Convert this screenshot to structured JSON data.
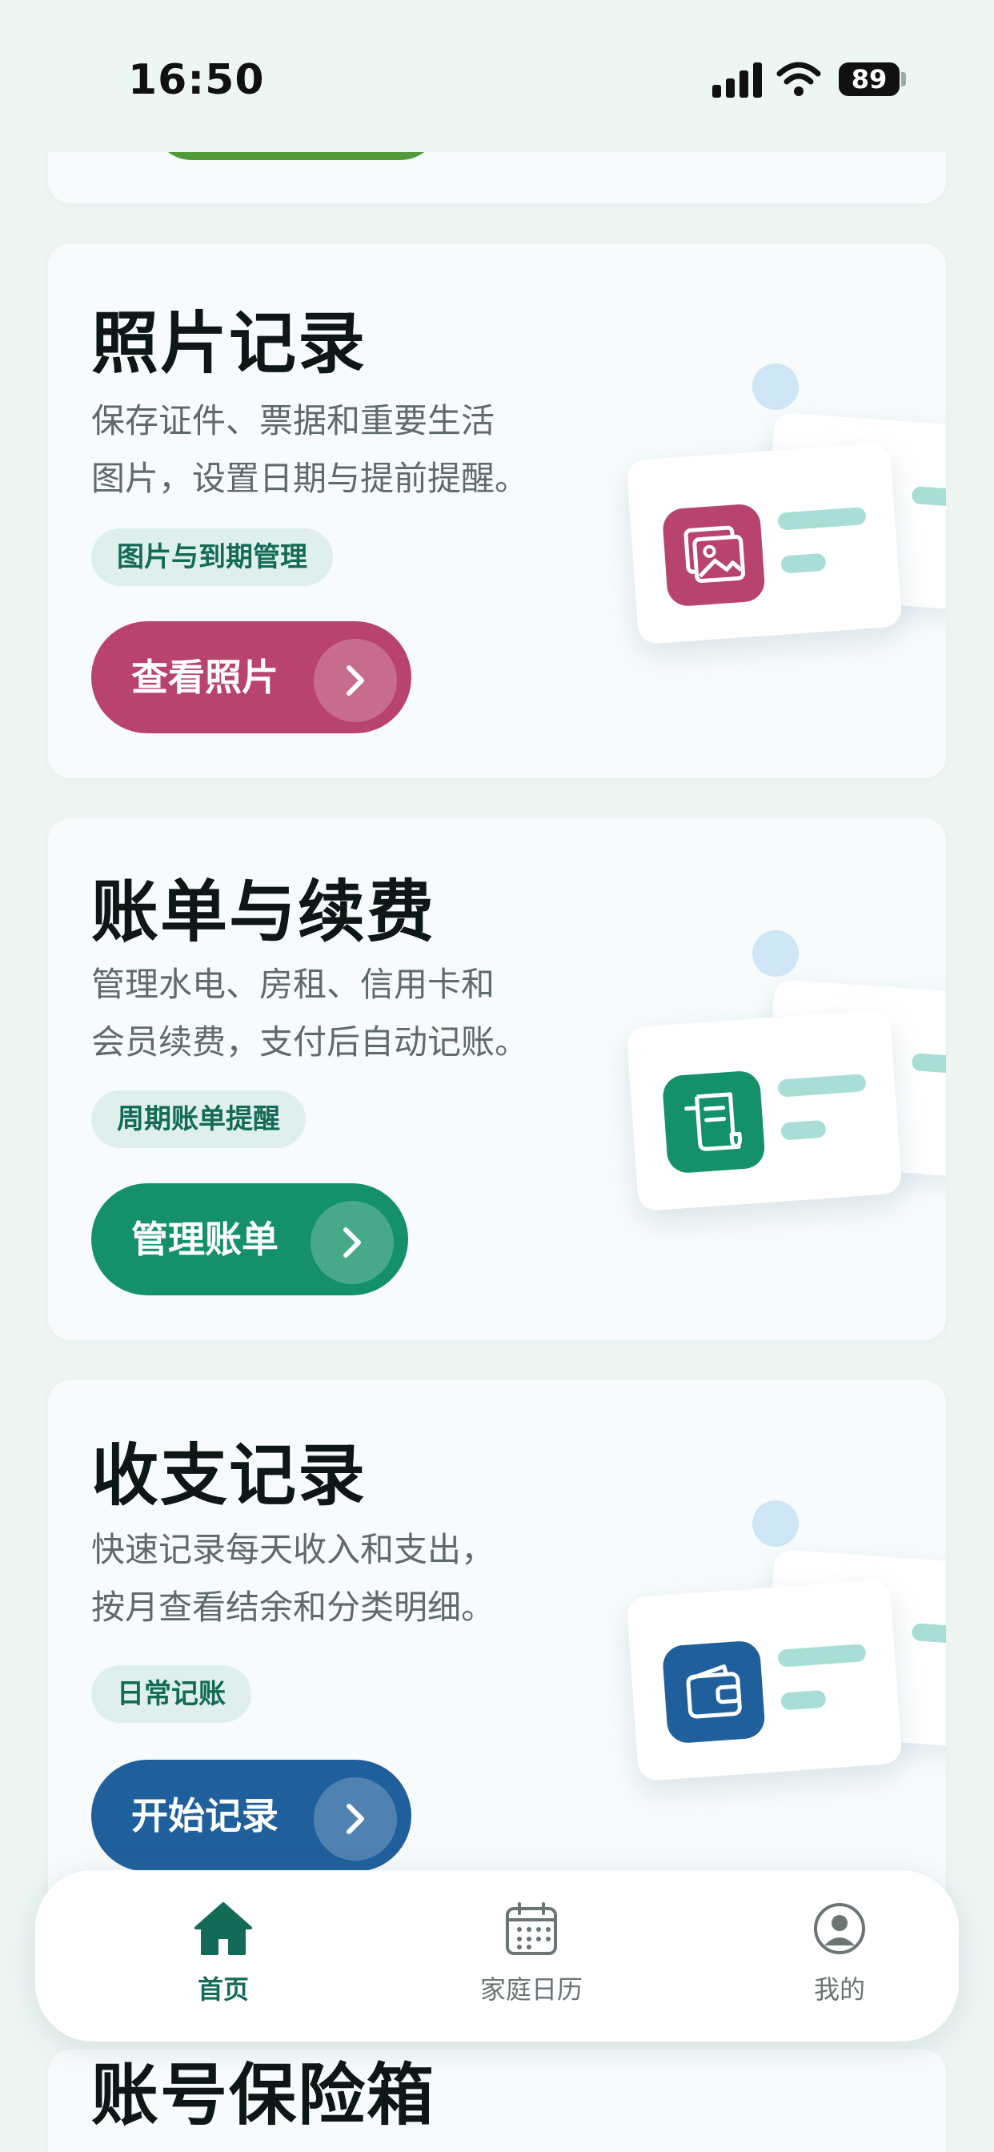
{
  "status_bar": {
    "time": "16:50",
    "battery": "89"
  },
  "cards": [
    {
      "title": "照片记录",
      "desc_line1": "保存证件、票据和重要生活",
      "desc_line2": "图片，设置日期与提前提醒。",
      "tag": "图片与到期管理",
      "action": "查看照片",
      "accent": "#b9436f",
      "icon": "photo-icon"
    },
    {
      "title": "账单与续费",
      "desc_line1": "管理水电、房租、信用卡和",
      "desc_line2": "会员续费，支付后自动记账。",
      "tag": "周期账单提醒",
      "action": "管理账单",
      "accent": "#14916a",
      "icon": "receipt-icon"
    },
    {
      "title": "收支记录",
      "desc_line1": "快速记录每天收入和支出，",
      "desc_line2": "按月查看结余和分类明细。",
      "tag": "日常记账",
      "action": "开始记录",
      "accent": "#1f5f9c",
      "icon": "wallet-icon"
    },
    {
      "title": "账号保险箱"
    }
  ],
  "tabbar": {
    "home": "首页",
    "calendar": "家庭日历",
    "me": "我的",
    "active_color": "#136b57"
  }
}
